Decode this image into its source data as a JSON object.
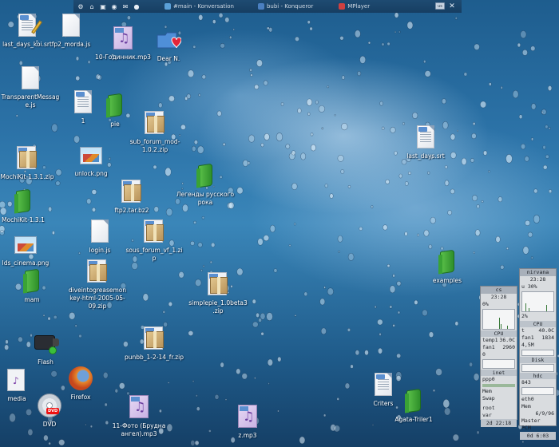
{
  "taskbar": {
    "launcher_icons": [
      "settings-icon",
      "home-icon",
      "terminal-icon",
      "web-icon",
      "email-icon",
      "globe-icon"
    ],
    "tasks": [
      {
        "label": "#main - Konversation",
        "color": "#5aa0d8"
      },
      {
        "label": "bubi - Konqueror",
        "color": "#4a7fc0"
      },
      {
        "label": "MPlayer",
        "color": "#d04040"
      }
    ],
    "tray": {
      "keyboard": "us",
      "close": "✕"
    }
  },
  "icons": {
    "last_days_koi": "last_days_koi.srt",
    "fp2_morda": "fp2_morda.js",
    "godinnik": "10-Годинник.mp3",
    "dear": "Dear N.",
    "transparent_message": "TransparentMessage.js",
    "one": "1",
    "pie": "pie",
    "sub_forum": "sub_forum_mod-1.0.2.zip",
    "last_days": "last_days.srt",
    "mochikit_zip": "MochiKit-1.3.1.zip",
    "unlock": "unlock.png",
    "legendy": "Легенды русского рока",
    "ftp2": "ftp2.tar.bz2",
    "mochikit": "MochiKit-1.3.1",
    "lds_cinema": "lds_cinema.png",
    "login": "login.js",
    "sous_forum": "sous_forum_vf_1.zip",
    "examples": "examples",
    "mam": "mam",
    "diveinto": "diveintogreasemonkey-html-2005-05-09.zip",
    "simplepie": "simplepie_1.0beta3.zip",
    "flash": "Flash",
    "punbb": "punbb_1-2-14_fr.zip",
    "media": "media",
    "firefox": "Firefox",
    "criters": "Criters",
    "agata": "Agata-Triler1",
    "dvd": "DVD",
    "foto": "11-Фото (Брудна ангел).mp3",
    "z": "z.mp3"
  },
  "monitor_right": {
    "host": "nirvana",
    "time": "23:28",
    "cpu_load": "u 30%",
    "cpu_pct": "2%",
    "cpu_label": "CPU",
    "temp_label": "t",
    "temp": "40.0C",
    "fan_label": "fan1",
    "fan": "1834",
    "disk_value": "4,5M",
    "disk_label": "Disk",
    "hdc_label": "hdc",
    "hdc_value": "843",
    "eth_label": "eth0",
    "mem_label": "Mem",
    "mem_value": "6/9/96",
    "master": "Master",
    "pcm": "PCM",
    "uptime": "0d 6:03"
  },
  "monitor_left": {
    "host": "cs",
    "time": "23:28",
    "cpu_pct": "0%",
    "cpu_label": "CPU",
    "temp_label": "temp1",
    "temp": "36.0C",
    "fan_label": "fan1",
    "fan": "2960",
    "inet_value": "0",
    "inet_label": "inet",
    "ppp_label": "ppp0",
    "mem_label": "Mem",
    "swap_label": "Swap",
    "root_label": "root",
    "var_label": "var",
    "uptime": "2d 22:18"
  }
}
